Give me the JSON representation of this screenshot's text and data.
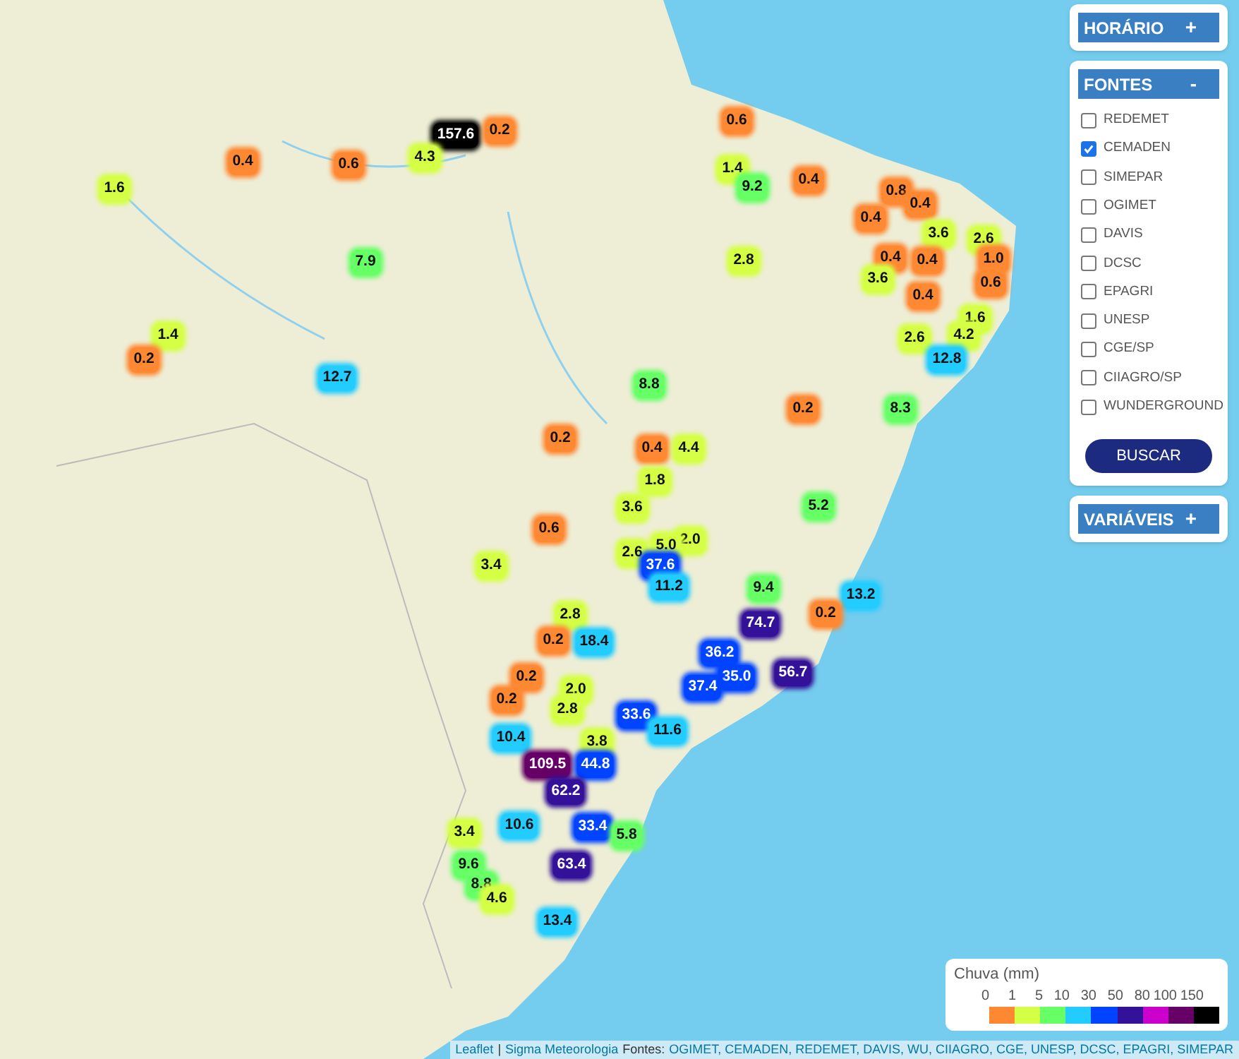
{
  "panels": [
    {
      "title": "HORÁRIO",
      "toggle": "+"
    },
    {
      "title": "FONTES",
      "toggle": "-",
      "sources": [
        {
          "label": "REDEMET",
          "checked": false
        },
        {
          "label": "CEMADEN",
          "checked": true
        },
        {
          "label": "SIMEPAR",
          "checked": false
        },
        {
          "label": "OGIMET",
          "checked": false
        },
        {
          "label": "DAVIS",
          "checked": false
        },
        {
          "label": "DCSC",
          "checked": false
        },
        {
          "label": "EPAGRI",
          "checked": false
        },
        {
          "label": "UNESP",
          "checked": false
        },
        {
          "label": "CGE/SP",
          "checked": false
        },
        {
          "label": "CIIAGRO/SP",
          "checked": false
        },
        {
          "label": "WUNDERGROUND",
          "checked": false
        }
      ],
      "button": "BUSCAR"
    },
    {
      "title": "VARIÁVEIS",
      "toggle": "+"
    }
  ],
  "markers": [
    {
      "value": "157.6",
      "color": "#000000"
    },
    {
      "value": "0.2",
      "color": "#ff8833"
    },
    {
      "value": "0.4",
      "color": "#ff8833"
    },
    {
      "value": "0.6",
      "color": "#ff8833"
    },
    {
      "value": "4.3",
      "color": "#d4ff44"
    },
    {
      "value": "1.6",
      "color": "#d4ff44"
    },
    {
      "value": "7.9",
      "color": "#66ff66"
    },
    {
      "value": "1.4",
      "color": "#d4ff44"
    },
    {
      "value": "0.2",
      "color": "#ff8833"
    },
    {
      "value": "12.7",
      "color": "#22ccff"
    },
    {
      "value": "0.6",
      "color": "#ff8833"
    },
    {
      "value": "1.4",
      "color": "#d4ff44"
    },
    {
      "value": "9.2",
      "color": "#66ff66"
    },
    {
      "value": "0.4",
      "color": "#ff8833"
    },
    {
      "value": "2.8",
      "color": "#d4ff44"
    },
    {
      "value": "0.8",
      "color": "#ff8833"
    },
    {
      "value": "0.4",
      "color": "#ff8833"
    },
    {
      "value": "0.4",
      "color": "#ff8833"
    },
    {
      "value": "3.6",
      "color": "#d4ff44"
    },
    {
      "value": "2.6",
      "color": "#d4ff44"
    },
    {
      "value": "0.4",
      "color": "#ff8833"
    },
    {
      "value": "0.4",
      "color": "#ff8833"
    },
    {
      "value": "1.0",
      "color": "#ff8833"
    },
    {
      "value": "3.6",
      "color": "#d4ff44"
    },
    {
      "value": "0.6",
      "color": "#ff8833"
    },
    {
      "value": "0.4",
      "color": "#ff8833"
    },
    {
      "value": "1.6",
      "color": "#d4ff44"
    },
    {
      "value": "2.6",
      "color": "#d4ff44"
    },
    {
      "value": "4.2",
      "color": "#d4ff44"
    },
    {
      "value": "12.8",
      "color": "#22ccff"
    },
    {
      "value": "8.8",
      "color": "#66ff66"
    },
    {
      "value": "0.2",
      "color": "#ff8833"
    },
    {
      "value": "8.3",
      "color": "#66ff66"
    },
    {
      "value": "0.2",
      "color": "#ff8833"
    },
    {
      "value": "0.4",
      "color": "#ff8833"
    },
    {
      "value": "4.4",
      "color": "#d4ff44"
    },
    {
      "value": "1.8",
      "color": "#d4ff44"
    },
    {
      "value": "3.6",
      "color": "#d4ff44"
    },
    {
      "value": "5.2",
      "color": "#66ff66"
    },
    {
      "value": "0.6",
      "color": "#ff8833"
    },
    {
      "value": "2.0",
      "color": "#d4ff44"
    },
    {
      "value": "5.0",
      "color": "#d4ff44"
    },
    {
      "value": "2.6",
      "color": "#d4ff44"
    },
    {
      "value": "3.4",
      "color": "#d4ff44"
    },
    {
      "value": "37.6",
      "color": "#0044ff"
    },
    {
      "value": "11.2",
      "color": "#22ccff"
    },
    {
      "value": "9.4",
      "color": "#66ff66"
    },
    {
      "value": "13.2",
      "color": "#22ccff"
    },
    {
      "value": "2.8",
      "color": "#d4ff44"
    },
    {
      "value": "0.2",
      "color": "#ff8833"
    },
    {
      "value": "74.7",
      "color": "#331199"
    },
    {
      "value": "0.2",
      "color": "#ff8833"
    },
    {
      "value": "18.4",
      "color": "#22ccff"
    },
    {
      "value": "36.2",
      "color": "#0044ff"
    },
    {
      "value": "35.0",
      "color": "#0044ff"
    },
    {
      "value": "56.7",
      "color": "#331199"
    },
    {
      "value": "37.4",
      "color": "#0044ff"
    },
    {
      "value": "0.2",
      "color": "#ff8833"
    },
    {
      "value": "2.0",
      "color": "#d4ff44"
    },
    {
      "value": "0.2",
      "color": "#ff8833"
    },
    {
      "value": "2.8",
      "color": "#d4ff44"
    },
    {
      "value": "33.6",
      "color": "#0044ff"
    },
    {
      "value": "11.6",
      "color": "#22ccff"
    },
    {
      "value": "10.4",
      "color": "#22ccff"
    },
    {
      "value": "3.8",
      "color": "#d4ff44"
    },
    {
      "value": "109.5",
      "color": "#660066"
    },
    {
      "value": "44.8",
      "color": "#0044ff"
    },
    {
      "value": "62.2",
      "color": "#331199"
    },
    {
      "value": "10.6",
      "color": "#22ccff"
    },
    {
      "value": "33.4",
      "color": "#0044ff"
    },
    {
      "value": "5.8",
      "color": "#66ff66"
    },
    {
      "value": "3.4",
      "color": "#d4ff44"
    },
    {
      "value": "9.6",
      "color": "#66ff66"
    },
    {
      "value": "8.8",
      "color": "#66ff66"
    },
    {
      "value": "4.6",
      "color": "#d4ff44"
    },
    {
      "value": "63.4",
      "color": "#331199"
    },
    {
      "value": "13.4",
      "color": "#22ccff"
    }
  ],
  "legend": {
    "title": "Chuva (mm)",
    "ticks": [
      "0",
      "1",
      "5",
      "10",
      "30",
      "50",
      "80",
      "100",
      "150"
    ],
    "bins": [
      {
        "color": "#ff8833"
      },
      {
        "color": "#d4ff44"
      },
      {
        "color": "#66ff66"
      },
      {
        "color": "#22ccff"
      },
      {
        "color": "#0044ff"
      },
      {
        "color": "#331199"
      },
      {
        "color": "#cc00cc"
      },
      {
        "color": "#660066"
      },
      {
        "color": "#000000"
      }
    ]
  },
  "attribution": [
    {
      "kind": "link",
      "text": "Leaflet"
    },
    {
      "kind": "text",
      "text": "|"
    },
    {
      "kind": "link",
      "text": "Sigma Meteorologia"
    },
    {
      "kind": "text",
      "text": "Fontes:"
    },
    {
      "kind": "link",
      "text": "OGIMET, CEMADEN, REDEMET, DAVIS, WU, CIIAGRO, CGE, UNESP, DCSC, EPAGRI, SIMEPAR"
    }
  ]
}
